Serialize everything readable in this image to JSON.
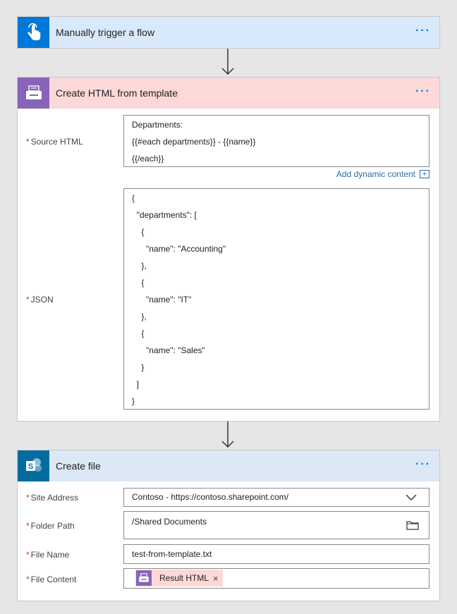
{
  "trigger": {
    "title": "Manually trigger a flow",
    "icon": "touch-hand-icon",
    "more": "···"
  },
  "html_template": {
    "title": "Create HTML from template",
    "icon": "printer-template-icon",
    "more": "···",
    "source_html": {
      "label": "Source HTML",
      "lines": [
        "Departments:",
        "{{#each departments}} - {{name}}",
        "{{/each}}"
      ]
    },
    "dynamic_content": "Add dynamic content",
    "json": {
      "label": "JSON",
      "lines": [
        "{",
        "  \"departments\": [",
        "    {",
        "      \"name\": \"Accounting\"",
        "    },",
        "    {",
        "      \"name\": \"IT\"",
        "    },",
        "    {",
        "      \"name\": \"Sales\"",
        "    }",
        "  ]",
        "}"
      ]
    }
  },
  "create_file": {
    "title": "Create file",
    "icon": "sharepoint-icon",
    "more": "···",
    "site_address": {
      "label": "Site Address",
      "value": "Contoso - https://contoso.sharepoint.com/"
    },
    "folder_path": {
      "label": "Folder Path",
      "value": "/Shared Documents"
    },
    "file_name": {
      "label": "File Name",
      "value": "test-from-template.txt"
    },
    "file_content": {
      "label": "File Content",
      "token": "Result HTML",
      "remove": "×"
    }
  },
  "colors": {
    "trigger_header": "#d8e9fb",
    "trigger_icon": "#0078d7",
    "html_header": "#fcd8d8",
    "html_icon": "#8764b8",
    "file_header": "#dce8f5",
    "file_icon": "#036c9f",
    "link": "#2b6ca3",
    "required": "#d13438"
  }
}
